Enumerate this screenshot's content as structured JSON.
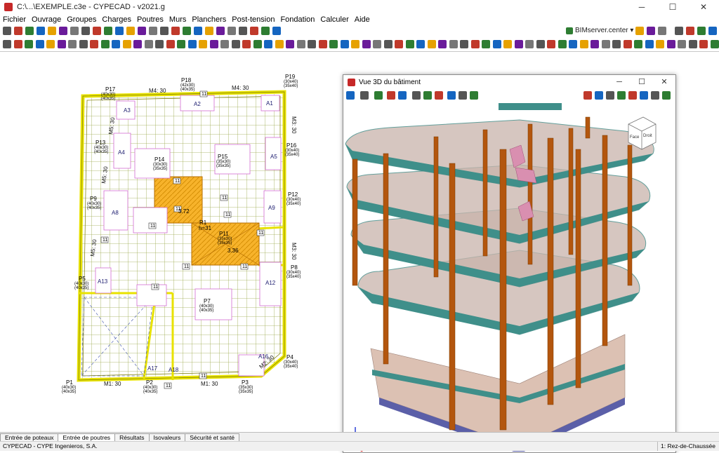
{
  "window": {
    "title": "C:\\...\\EXEMPLE.c3e - CYPECAD - v2021.g",
    "min": "─",
    "max": "☐",
    "close": "✕"
  },
  "menu": [
    "Fichier",
    "Ouvrage",
    "Groupes",
    "Charges",
    "Poutres",
    "Murs",
    "Planchers",
    "Post-tension",
    "Fondation",
    "Calculer",
    "Aide"
  ],
  "toolbar": {
    "bimserver_label": "BIMserver.center ▾"
  },
  "plan": {
    "columns": [
      {
        "name": "P17",
        "dims": [
          "(40x30)",
          "(40x35)"
        ]
      },
      {
        "name": "P18",
        "dims": [
          "(42x30)",
          "(40x35)"
        ]
      },
      {
        "name": "P19",
        "dims": [
          "(30x40)",
          "(35x40)"
        ]
      },
      {
        "name": "P13",
        "dims": [
          "(40x30)",
          "(40x35)"
        ]
      },
      {
        "name": "P16",
        "dims": [
          "(30x40)",
          "(35x40)"
        ]
      },
      {
        "name": "P14",
        "dims": [
          "(30x30)",
          "(35x35)"
        ]
      },
      {
        "name": "P15",
        "dims": [
          "(35x30)",
          "(35x35)"
        ]
      },
      {
        "name": "P12",
        "dims": [
          "(30x40)",
          "(35x40)"
        ]
      },
      {
        "name": "P9",
        "dims": [
          "(40x30)",
          "(40x35)"
        ]
      },
      {
        "name": "P11",
        "dims": [
          "(35x30)",
          "(35x35)"
        ]
      },
      {
        "name": "P8",
        "dims": [
          "(30x40)",
          "(35x40)"
        ]
      },
      {
        "name": "P5",
        "dims": [
          "(40x30)",
          "(40x35)"
        ]
      },
      {
        "name": "P7",
        "dims": [
          "(40x30)",
          "(40x35)"
        ]
      },
      {
        "name": "P4",
        "dims": [
          "(30x40)",
          "(35x40)"
        ]
      },
      {
        "name": "P1",
        "dims": [
          "(40x30)",
          "(40x35)"
        ]
      },
      {
        "name": "P2",
        "dims": [
          "(40x30)",
          "(40x35)"
        ]
      },
      {
        "name": "P3",
        "dims": [
          "(35x30)",
          "(35x35)"
        ]
      }
    ],
    "zones": [
      "A1",
      "A2",
      "A3",
      "A4",
      "A5",
      "A8",
      "A9",
      "A12",
      "A13",
      "A16",
      "A17",
      "A18"
    ],
    "beams": [
      "M4: 30",
      "M4: 30",
      "M5: 30",
      "M5: 30",
      "M5: 30",
      "M3: 30",
      "M3: 30",
      "M1: 30",
      "M1: 30",
      "M2: 30"
    ],
    "ramp_labels": [
      "R1",
      "h=31"
    ],
    "slab_labels": [
      "3.72",
      "3.36"
    ],
    "eleven": "11"
  },
  "view3d": {
    "title": "Vue 3D du bâtiment",
    "cube_labels": [
      "Face",
      "Droit"
    ]
  },
  "tabs": [
    "Entrée de poteaux",
    "Entrée de poutres",
    "Résultats",
    "Isovaleurs",
    "Sécurité et santé"
  ],
  "status": {
    "left": "CYPECAD - CYPE Ingenieros, S.A.",
    "right": "1: Rez-de-Chaussée"
  }
}
